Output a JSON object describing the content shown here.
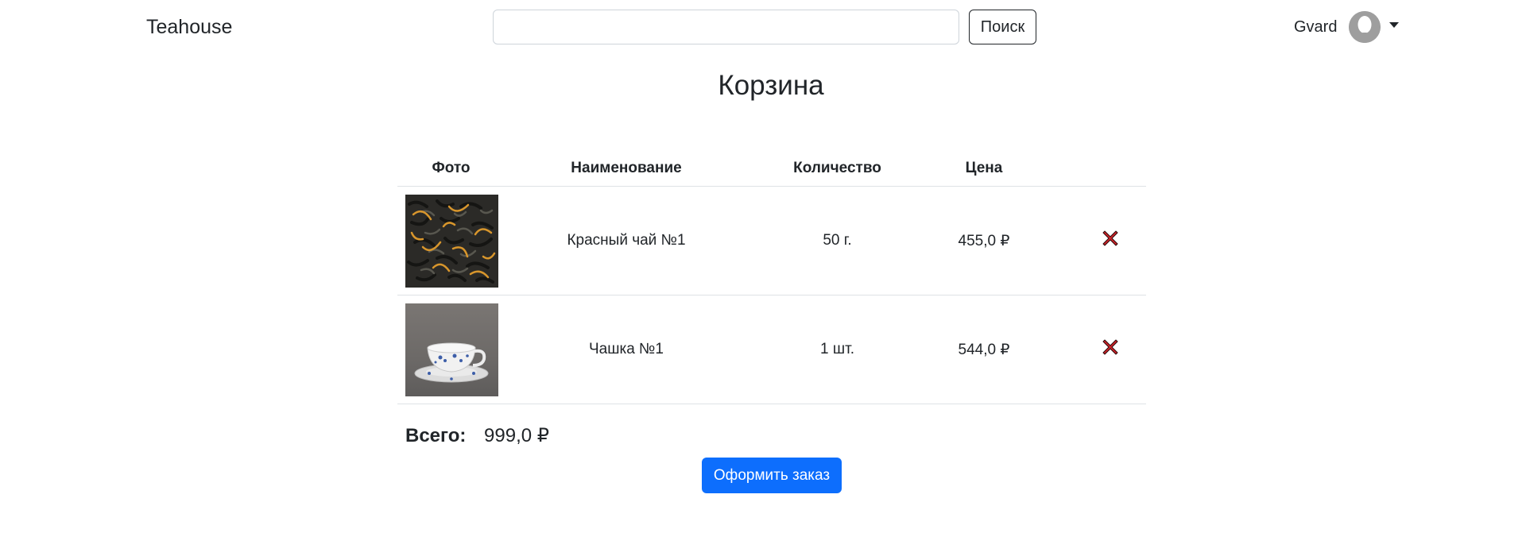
{
  "navbar": {
    "brand": "Teahouse",
    "search_value": "",
    "search_button_label": "Поиск",
    "user_name": "Gvard"
  },
  "page": {
    "title": "Корзина"
  },
  "cart": {
    "columns": {
      "photo": "Фото",
      "name": "Наименование",
      "quantity": "Количество",
      "price": "Цена"
    },
    "items": [
      {
        "name": "Красный чай №1",
        "quantity": "50 г.",
        "price": "455,0 ₽",
        "image": "loose-leaf-tea-photo",
        "delete_icon": "close-icon"
      },
      {
        "name": "Чашка №1",
        "quantity": "1 шт.",
        "price": "544,0 ₽",
        "image": "tea-cup-photo",
        "delete_icon": "close-icon"
      }
    ],
    "total_label": "Всего:",
    "total_value": "999,0 ₽",
    "order_button_label": "Оформить заказ"
  },
  "colors": {
    "primary": "#0d6efd",
    "delete": "#d0242a",
    "text": "#212529",
    "border": "#dee2e6"
  }
}
